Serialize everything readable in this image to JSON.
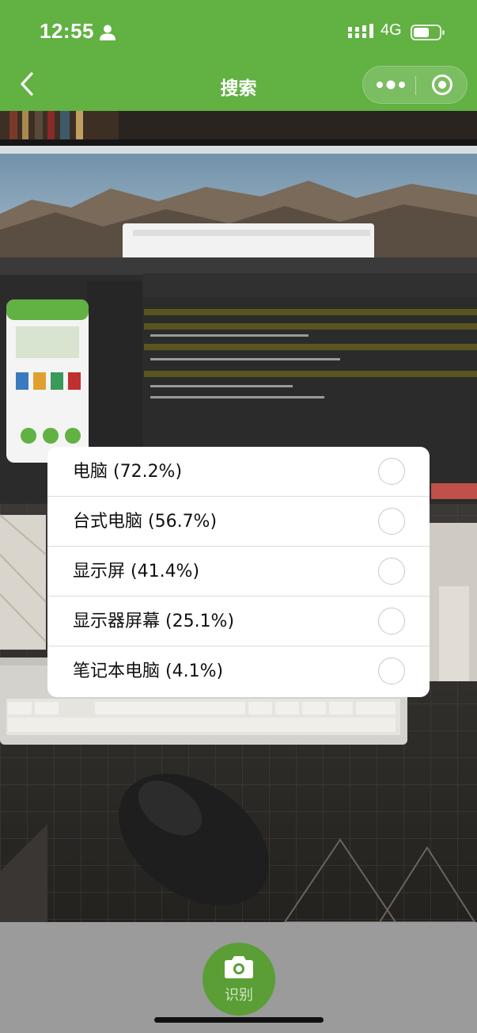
{
  "status_bar": {
    "time": "12:55",
    "network": "4G"
  },
  "nav": {
    "title": "搜索"
  },
  "results": [
    {
      "label": "电脑 (72.2%)"
    },
    {
      "label": "台式电脑 (56.7%)"
    },
    {
      "label": "显示屏 (41.4%)"
    },
    {
      "label": "显示器屏幕 (25.1%)"
    },
    {
      "label": "笔记本电脑 (4.1%)"
    }
  ],
  "bottom": {
    "shoot_label": "识别"
  },
  "colors": {
    "brand_green": "#62b143",
    "button_green": "#5a9e35",
    "bottom_bar": "#9b9b9b"
  },
  "icons": [
    "person-icon",
    "signal-icon",
    "battery-icon",
    "back-arrow-icon",
    "more-dots-icon",
    "close-target-icon",
    "camera-icon"
  ]
}
